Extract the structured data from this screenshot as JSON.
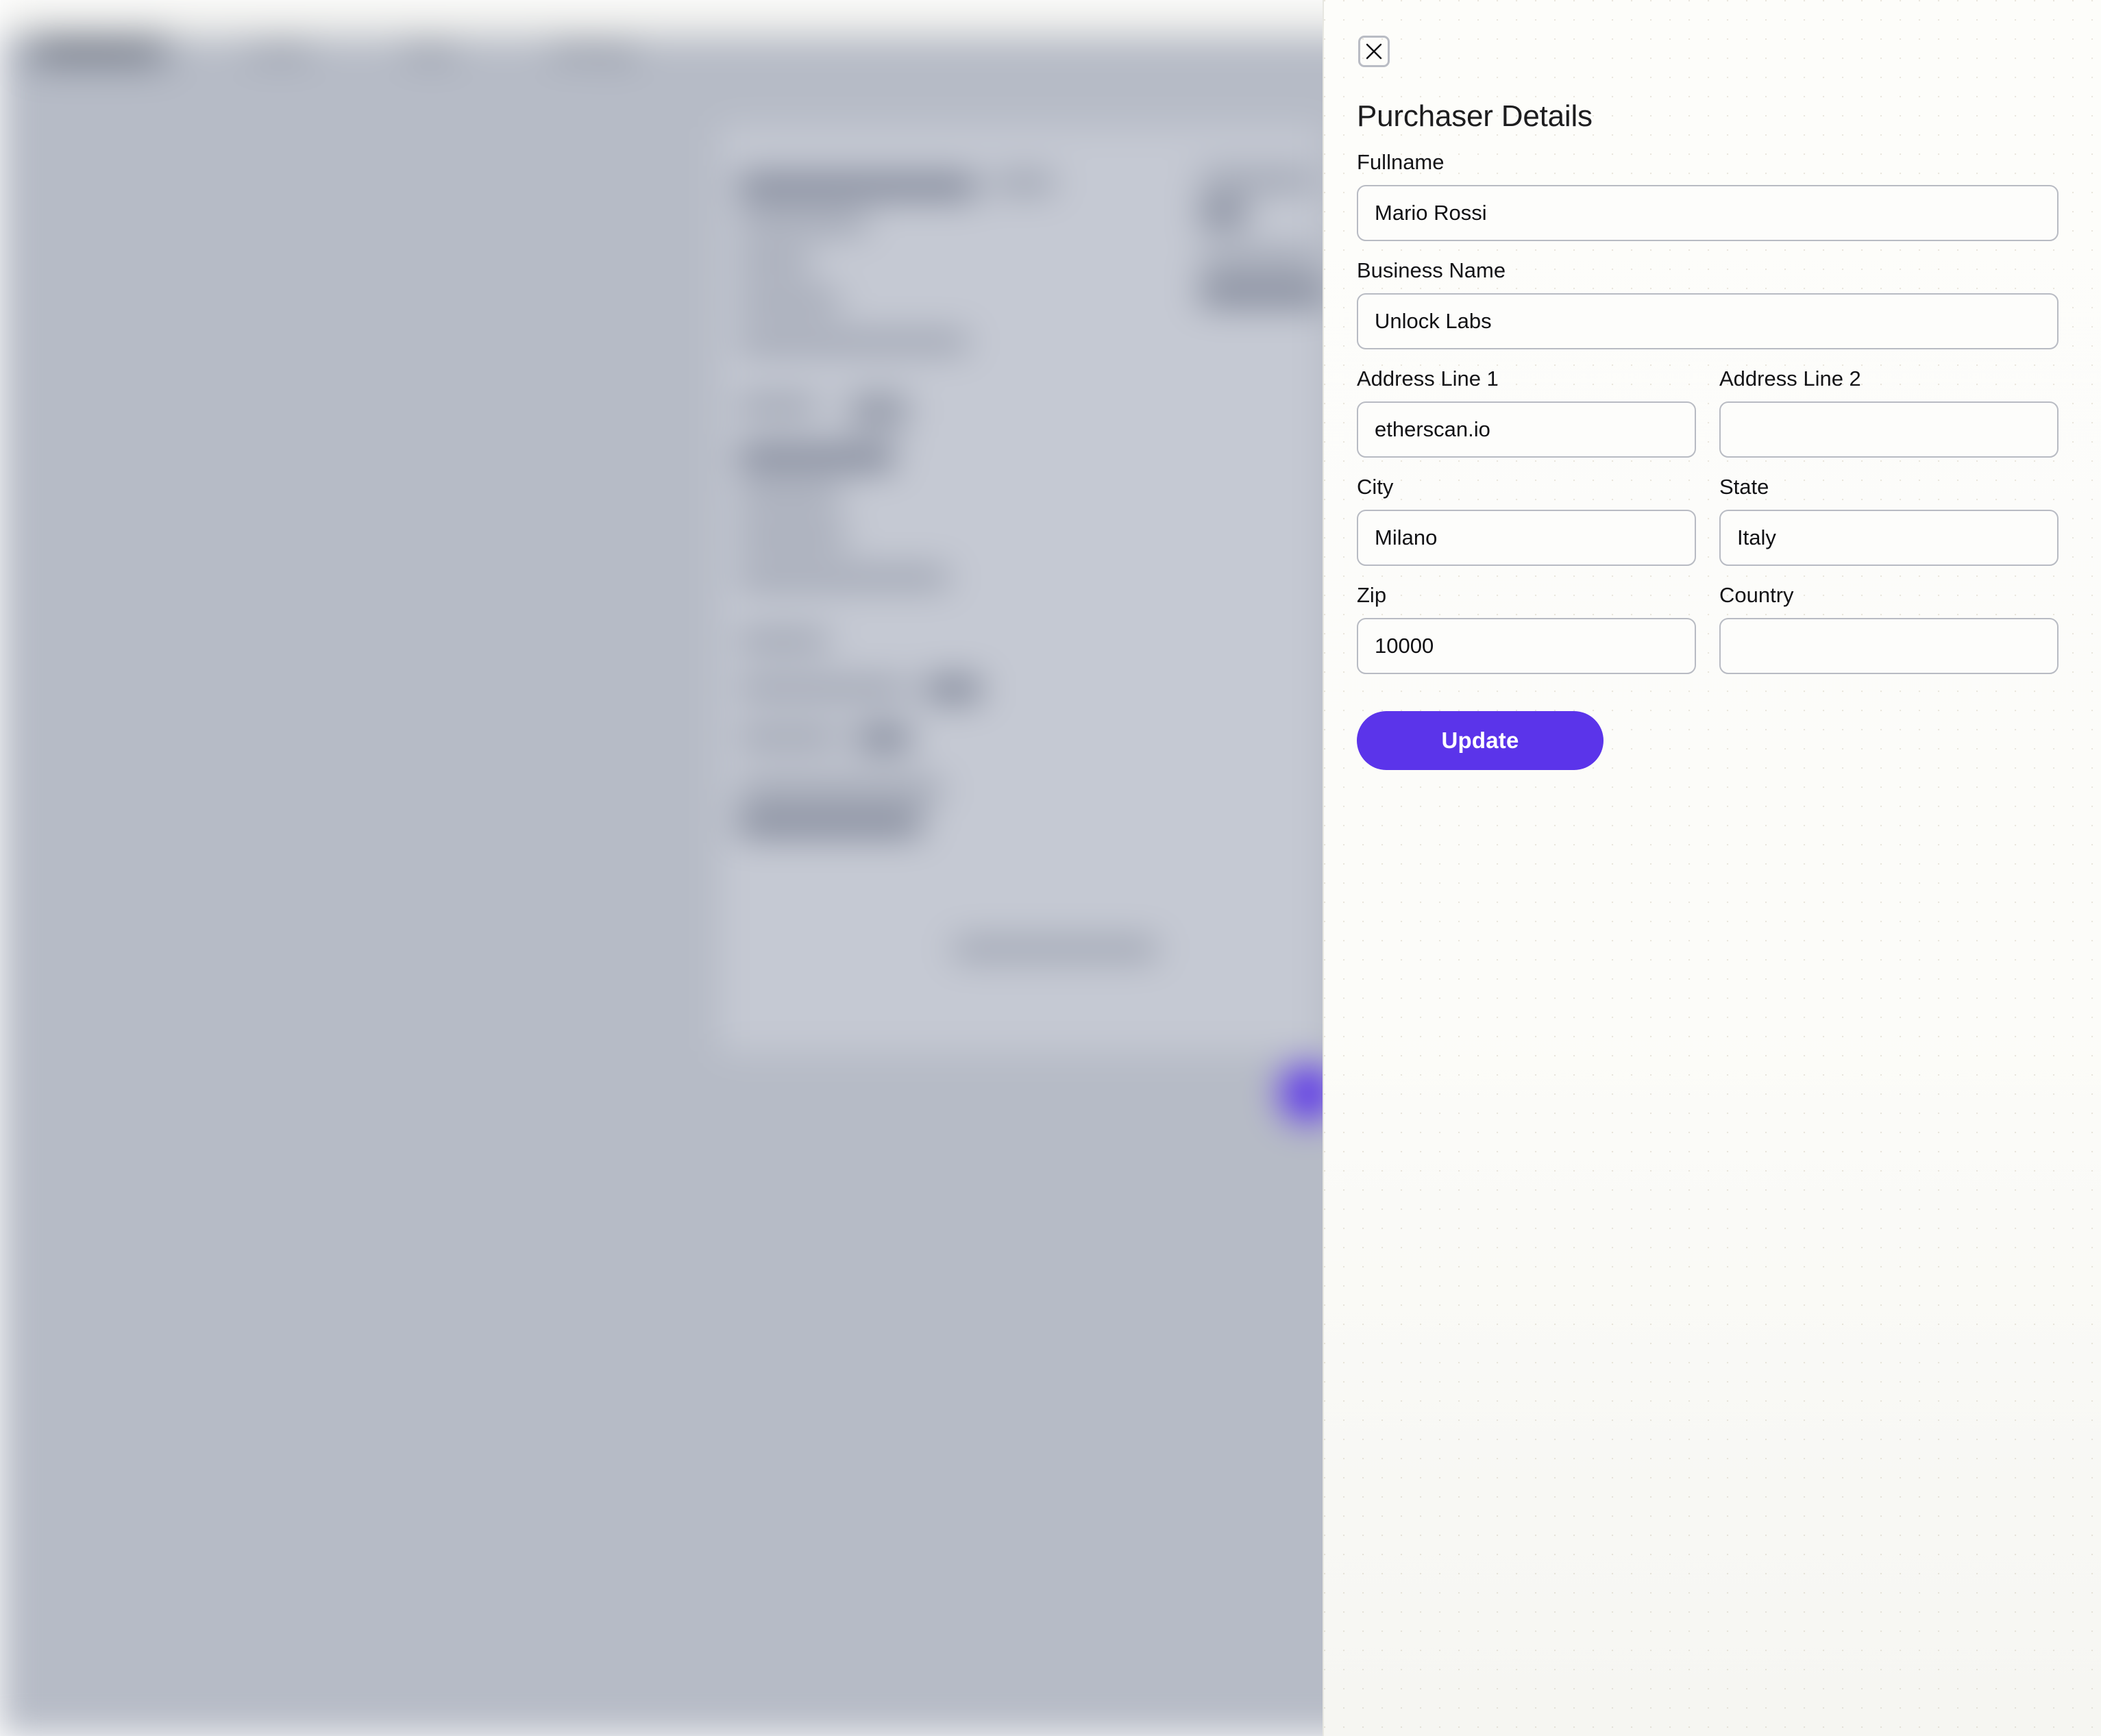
{
  "background": {
    "nav": {
      "items": [
        {
          "label": "Dashboard",
          "active": true
        },
        {
          "label": "Locks",
          "active": false
        },
        {
          "label": "Keys",
          "active": false
        },
        {
          "label": "Settings",
          "active": false
        }
      ]
    },
    "receipt_card": {
      "note": "blurred receipt preview",
      "footer": "Powered by Unlock"
    },
    "fab": {
      "name": "help-fab",
      "color": "#5b34ea"
    }
  },
  "drawer": {
    "close_label": "X",
    "title": "Purchaser Details",
    "fields": {
      "fullname": {
        "label": "Fullname",
        "value": "Mario Rossi",
        "placeholder": ""
      },
      "business_name": {
        "label": "Business Name",
        "value": "Unlock Labs",
        "placeholder": ""
      },
      "address_line_1": {
        "label": "Address Line 1",
        "value": "etherscan.io",
        "placeholder": ""
      },
      "address_line_2": {
        "label": "Address Line 2",
        "value": "",
        "placeholder": ""
      },
      "city": {
        "label": "City",
        "value": "Milano",
        "placeholder": ""
      },
      "state": {
        "label": "State",
        "value": "Italy",
        "placeholder": ""
      },
      "zip": {
        "label": "Zip",
        "value": "10000",
        "placeholder": ""
      },
      "country": {
        "label": "Country",
        "value": "",
        "placeholder": ""
      }
    },
    "submit_label": "Update",
    "accent_color": "#5b34ea"
  }
}
